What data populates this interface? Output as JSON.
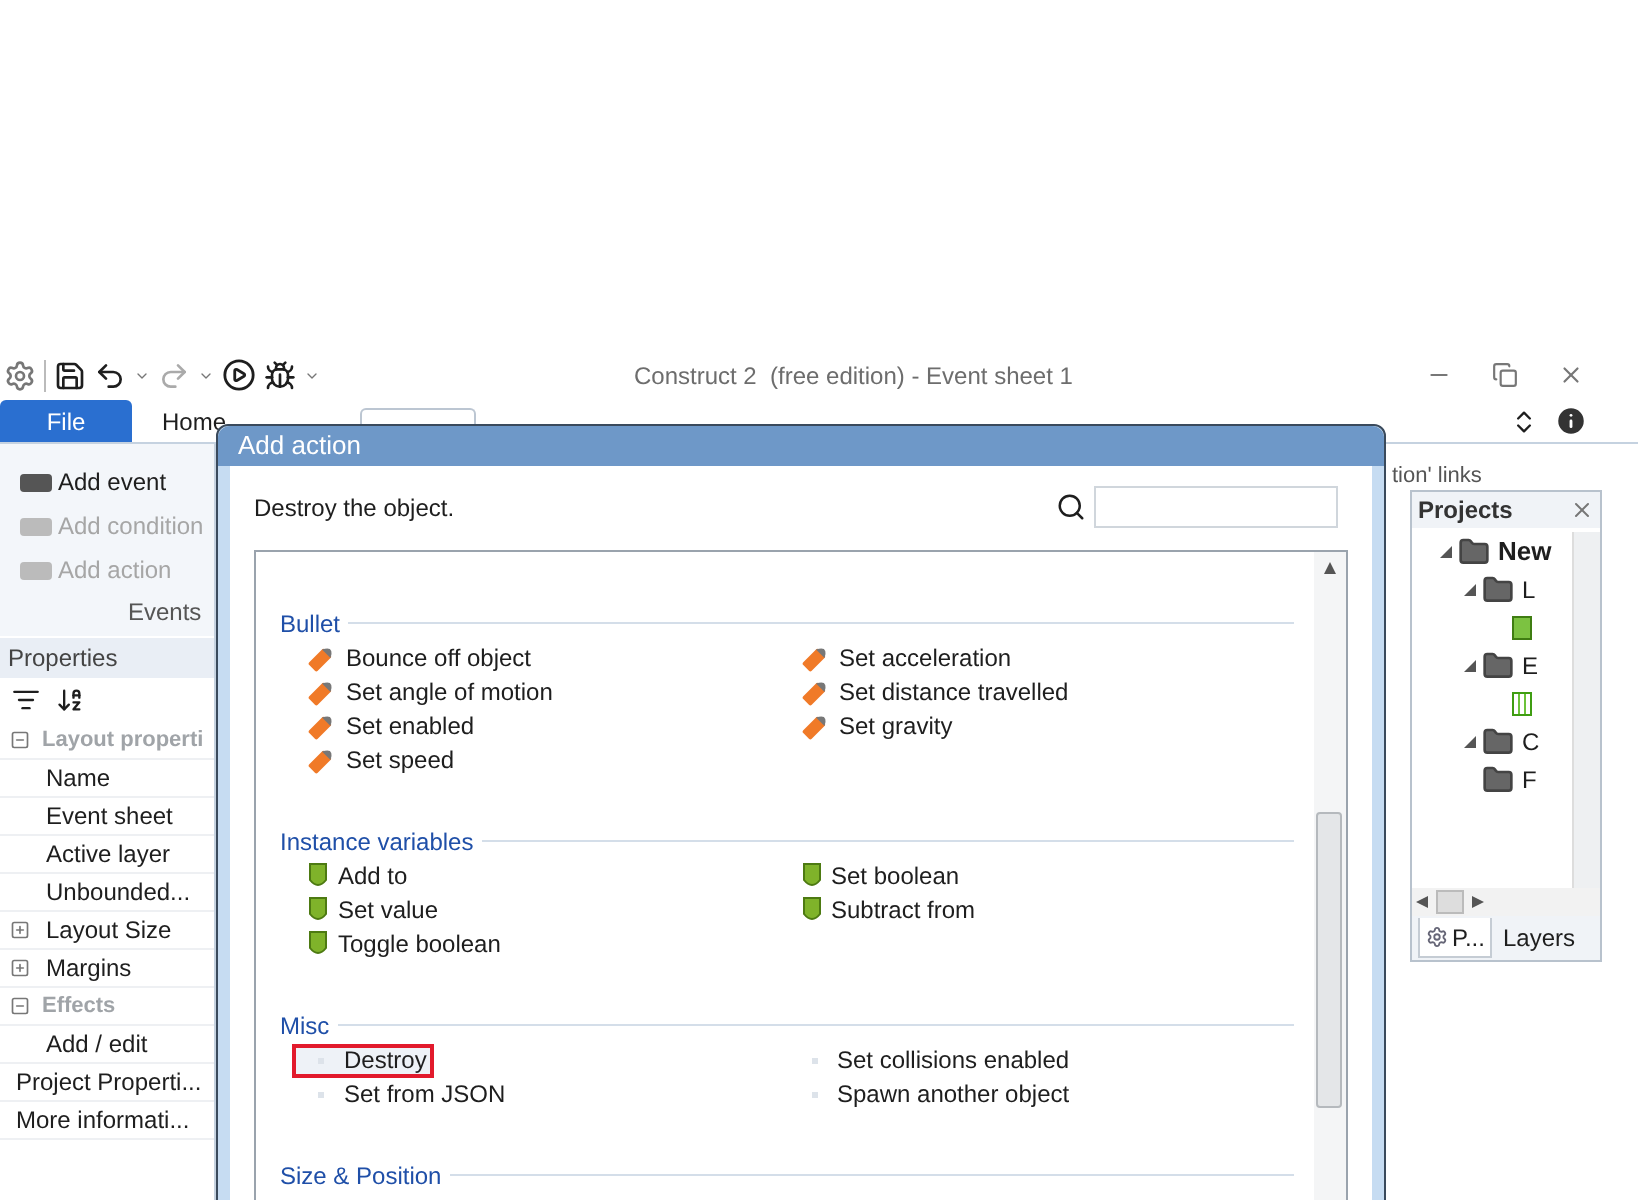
{
  "window": {
    "title": "Construct 2  (free edition) - Event sheet 1"
  },
  "ribbon_tabs": [
    {
      "label": "File",
      "kind": "file"
    },
    {
      "label": "Home",
      "kind": "tab"
    }
  ],
  "ribbon_group": {
    "label": "Events",
    "buttons": [
      {
        "label": "Add event",
        "disabled": false
      },
      {
        "label": "Add condition",
        "disabled": true
      },
      {
        "label": "Add action",
        "disabled": true
      }
    ]
  },
  "behind_text": "tion' links",
  "properties": {
    "title": "Properties",
    "rows": [
      {
        "label": "Layout properti",
        "expanded": true,
        "children": [
          {
            "label": "Name"
          },
          {
            "label": "Event sheet"
          },
          {
            "label": "Active layer"
          },
          {
            "label": "Unbounded..."
          },
          {
            "label": "Layout Size",
            "expanded": false
          },
          {
            "label": "Margins",
            "expanded": false
          }
        ]
      },
      {
        "label": "Effects",
        "expanded": true,
        "children": [
          {
            "label": "Add / edit"
          }
        ]
      },
      {
        "label": "Project Properti..."
      },
      {
        "label": "More informati..."
      }
    ]
  },
  "projects": {
    "title": "Projects",
    "tree": [
      {
        "label": "New",
        "kind": "folder",
        "expanded": true,
        "children": [
          {
            "label": "L",
            "kind": "folder",
            "expanded": true,
            "children": [
              {
                "kind": "sprite"
              }
            ]
          },
          {
            "label": "E",
            "kind": "folder",
            "expanded": true,
            "children": [
              {
                "kind": "sheet"
              }
            ]
          },
          {
            "label": "C",
            "kind": "folder",
            "expanded": true
          },
          {
            "label": "F",
            "kind": "folder",
            "expanded": false
          }
        ]
      }
    ],
    "tabs": [
      {
        "label": "P...",
        "selected": true
      },
      {
        "label": "Layers",
        "selected": false
      }
    ]
  },
  "dialog": {
    "title": "Add action",
    "description": "Destroy the object.",
    "sections": [
      {
        "title": "Bullet",
        "kind": "bullet",
        "items": [
          {
            "label": "Bounce off object",
            "selected": false
          },
          {
            "label": "Set angle of motion",
            "selected": false
          },
          {
            "label": "Set enabled",
            "selected": false
          },
          {
            "label": "Set speed",
            "selected": false
          },
          {
            "label": "Set acceleration",
            "selected": false
          },
          {
            "label": "Set distance travelled",
            "selected": false
          },
          {
            "label": "Set gravity",
            "selected": false
          }
        ]
      },
      {
        "title": "Instance variables",
        "kind": "variable",
        "items": [
          {
            "label": "Add to",
            "selected": false
          },
          {
            "label": "Set value",
            "selected": false
          },
          {
            "label": "Toggle boolean",
            "selected": false
          },
          {
            "label": "Set boolean",
            "selected": false
          },
          {
            "label": "Subtract from",
            "selected": false
          }
        ]
      },
      {
        "title": "Misc",
        "kind": "misc",
        "items": [
          {
            "label": "Destroy",
            "selected": true
          },
          {
            "label": "Set from JSON",
            "selected": false
          },
          {
            "label": "Set collisions enabled",
            "selected": false
          },
          {
            "label": "Spawn another object",
            "selected": false
          }
        ]
      },
      {
        "title": "Size & Position"
      }
    ]
  }
}
